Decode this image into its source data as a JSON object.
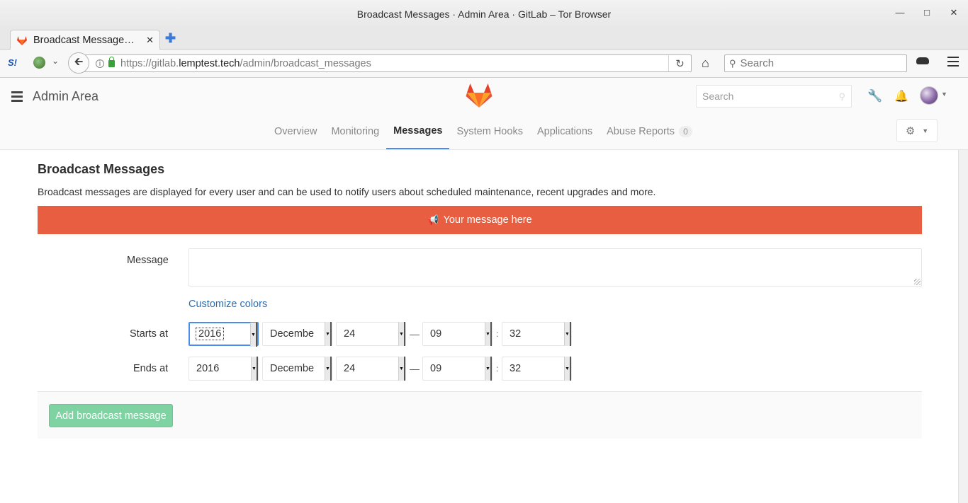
{
  "browser": {
    "window_title": "Broadcast Messages · Admin Area · GitLab – Tor Browser",
    "tab_title": "Broadcast Message…",
    "url_prefix": "https://gitlab.",
    "url_host": "lemptest.tech",
    "url_path": "/admin/broadcast_messages",
    "search_placeholder": "Search"
  },
  "header": {
    "area_title": "Admin Area",
    "search_placeholder": "Search"
  },
  "subnav": {
    "tabs": [
      {
        "label": "Overview"
      },
      {
        "label": "Monitoring"
      },
      {
        "label": "Messages",
        "active": true
      },
      {
        "label": "System Hooks"
      },
      {
        "label": "Applications"
      },
      {
        "label": "Abuse Reports",
        "badge": "0"
      }
    ]
  },
  "page": {
    "title": "Broadcast Messages",
    "description": "Broadcast messages are displayed for every user and can be used to notify users about scheduled maintenance, recent upgrades and more.",
    "preview_text": "Your message here",
    "preview_color": "#e75e40"
  },
  "form": {
    "message_label": "Message",
    "message_value": "",
    "customize_colors": "Customize colors",
    "starts_label": "Starts at",
    "ends_label": "Ends at",
    "starts": {
      "year": "2016",
      "month": "Decembe",
      "day": "24",
      "hour": "09",
      "minute": "32"
    },
    "ends": {
      "year": "2016",
      "month": "Decembe",
      "day": "24",
      "hour": "09",
      "minute": "32"
    },
    "dash": "—",
    "colon": ":",
    "submit_label": "Add broadcast message",
    "submit_color": "#7fd3a2"
  }
}
